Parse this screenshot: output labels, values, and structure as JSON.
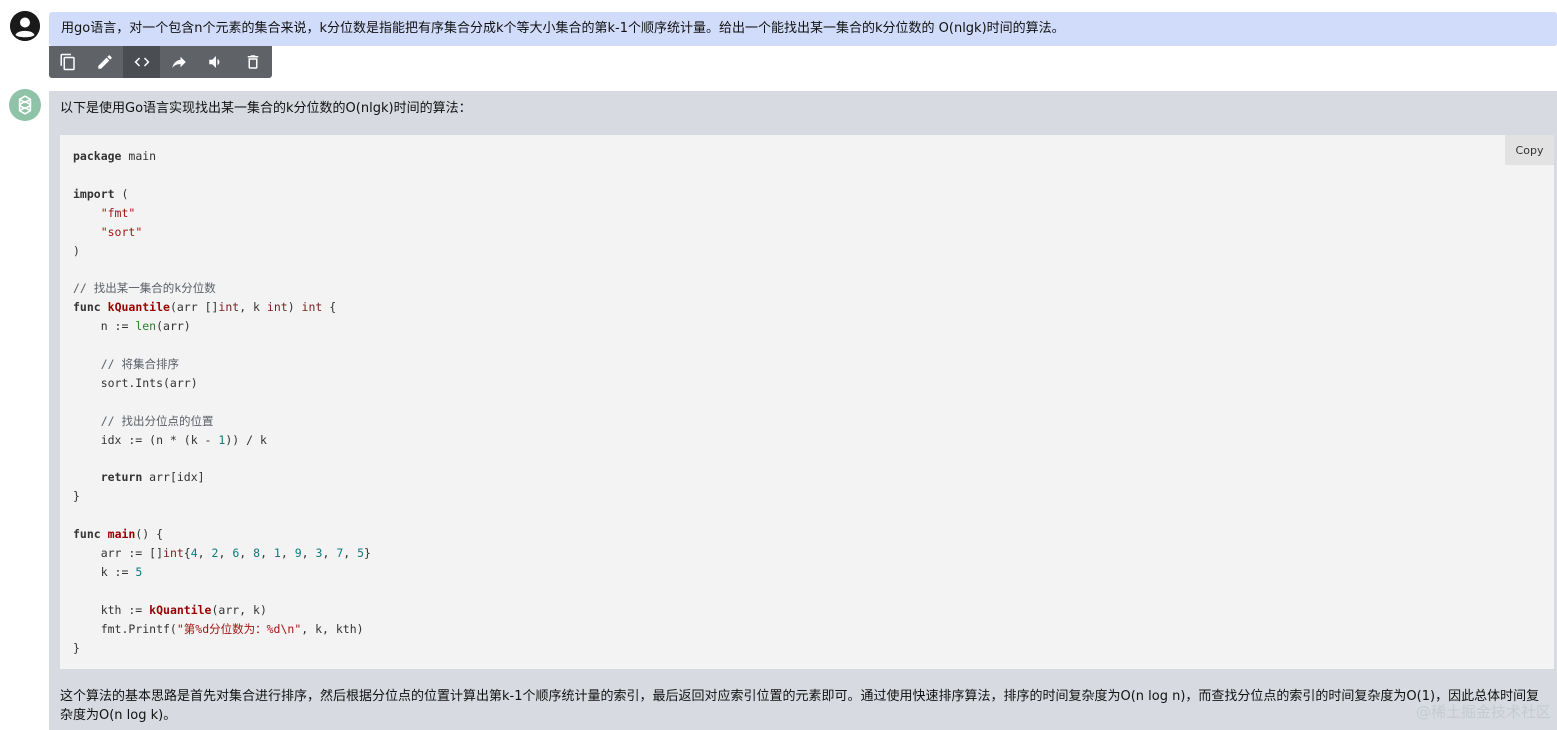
{
  "user": {
    "message": "用go语言，对一个包含n个元素的集合来说，k分位数是指能把有序集合分成k个等大小集合的第k-1个顺序统计量。给出一个能找出某一集合的k分位数的 O(nlgk)时间的算法。"
  },
  "toolbar": {
    "items": [
      {
        "name": "copy-icon"
      },
      {
        "name": "edit-icon"
      },
      {
        "name": "code-icon"
      },
      {
        "name": "share-icon"
      },
      {
        "name": "speaker-icon"
      },
      {
        "name": "trash-icon"
      }
    ]
  },
  "assistant": {
    "intro": "以下是使用Go语言实现找出某一集合的k分位数的O(nlgk)时间的算法：",
    "copy_label": "Copy",
    "code_lines": [
      "package main",
      "",
      "import (",
      "    \"fmt\"",
      "    \"sort\"",
      ")",
      "",
      "// 找出某一集合的k分位数",
      "func kQuantile(arr []int, k int) int {",
      "    n := len(arr)",
      "",
      "    // 将集合排序",
      "    sort.Ints(arr)",
      "",
      "    // 找出分位点的位置",
      "    idx := (n * (k - 1)) / k",
      "",
      "    return arr[idx]",
      "}",
      "",
      "func main() {",
      "    arr := []int{4, 2, 6, 8, 1, 9, 3, 7, 5}",
      "    k := 5",
      "",
      "    kth := kQuantile(arr, k)",
      "    fmt.Printf(\"第%d分位数为：%d\\n\", k, kth)",
      "}"
    ],
    "summary": "这个算法的基本思路是首先对集合进行排序，然后根据分位点的位置计算出第k-1个顺序统计量的索引，最后返回对应索引位置的元素即可。通过使用快速排序算法，排序的时间复杂度为O(n log n)，而查找分位点的索引的时间复杂度为O(1)，因此总体时间复杂度为O(n log k)。"
  },
  "watermark": "@稀土掘金技术社区"
}
